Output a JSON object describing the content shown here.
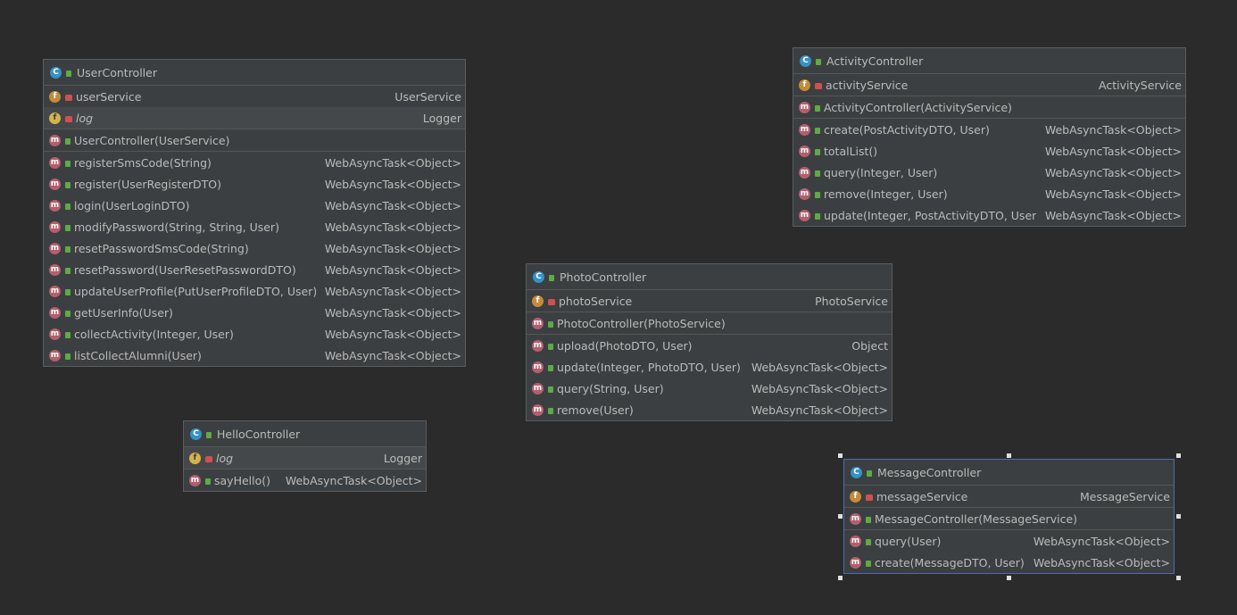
{
  "classes": {
    "user": {
      "title": "UserController",
      "fields": [
        {
          "name": "userService",
          "type": "UserService",
          "icon": "field-icon"
        },
        {
          "name": "log",
          "type": "Logger",
          "icon": "static-field-icon"
        }
      ],
      "ctor": "UserController(UserService)",
      "methods": [
        {
          "name": "registerSmsCode(String)",
          "type": "WebAsyncTask<Object>"
        },
        {
          "name": "register(UserRegisterDTO)",
          "type": "WebAsyncTask<Object>"
        },
        {
          "name": "login(UserLoginDTO)",
          "type": "WebAsyncTask<Object>"
        },
        {
          "name": "modifyPassword(String, String, User)",
          "type": "WebAsyncTask<Object>"
        },
        {
          "name": "resetPasswordSmsCode(String)",
          "type": "WebAsyncTask<Object>"
        },
        {
          "name": "resetPassword(UserResetPasswordDTO)",
          "type": "WebAsyncTask<Object>"
        },
        {
          "name": "updateUserProfile(PutUserProfileDTO, User)",
          "type": "WebAsyncTask<Object>"
        },
        {
          "name": "getUserInfo(User)",
          "type": "WebAsyncTask<Object>"
        },
        {
          "name": "collectActivity(Integer, User)",
          "type": "WebAsyncTask<Object>"
        },
        {
          "name": "listCollectAlumni(User)",
          "type": "WebAsyncTask<Object>"
        }
      ]
    },
    "hello": {
      "title": "HelloController",
      "fields": [
        {
          "name": "log",
          "type": "Logger"
        }
      ],
      "methods": [
        {
          "name": "sayHello()",
          "type": "WebAsyncTask<Object>"
        }
      ]
    },
    "photo": {
      "title": "PhotoController",
      "fields": [
        {
          "name": "photoService",
          "type": "PhotoService"
        }
      ],
      "ctor": "PhotoController(PhotoService)",
      "methods": [
        {
          "name": "upload(PhotoDTO, User)",
          "type": "Object"
        },
        {
          "name": "update(Integer, PhotoDTO, User)",
          "type": "WebAsyncTask<Object>"
        },
        {
          "name": "query(String, User)",
          "type": "WebAsyncTask<Object>"
        },
        {
          "name": "remove(User)",
          "type": "WebAsyncTask<Object>"
        }
      ]
    },
    "activity": {
      "title": "ActivityController",
      "fields": [
        {
          "name": "activityService",
          "type": "ActivityService"
        }
      ],
      "ctor": "ActivityController(ActivityService)",
      "methods": [
        {
          "name": "create(PostActivityDTO, User)",
          "type": "WebAsyncTask<Object>"
        },
        {
          "name": "totalList()",
          "type": "WebAsyncTask<Object>"
        },
        {
          "name": "query(Integer, User)",
          "type": "WebAsyncTask<Object>"
        },
        {
          "name": "remove(Integer, User)",
          "type": "WebAsyncTask<Object>"
        },
        {
          "name": "update(Integer, PostActivityDTO, User)",
          "type": "WebAsyncTask<Object>"
        }
      ]
    },
    "message": {
      "title": "MessageController",
      "fields": [
        {
          "name": "messageService",
          "type": "MessageService"
        }
      ],
      "ctor": "MessageController(MessageService)",
      "methods": [
        {
          "name": "query(User)",
          "type": "WebAsyncTask<Object>"
        },
        {
          "name": "create(MessageDTO, User)",
          "type": "WebAsyncTask<Object>"
        }
      ]
    }
  },
  "icons": {
    "class": "C",
    "field": "f",
    "method": "m"
  },
  "colors": {
    "background": "#2b2b2b",
    "panel": "#3c3f41",
    "class_icon": "#3592c4",
    "field_icon": "#c48b3a",
    "method_icon": "#b35f6e",
    "private_lock": "#d05050",
    "public_lock": "#5faa44",
    "selection": "#4b6eaf"
  }
}
